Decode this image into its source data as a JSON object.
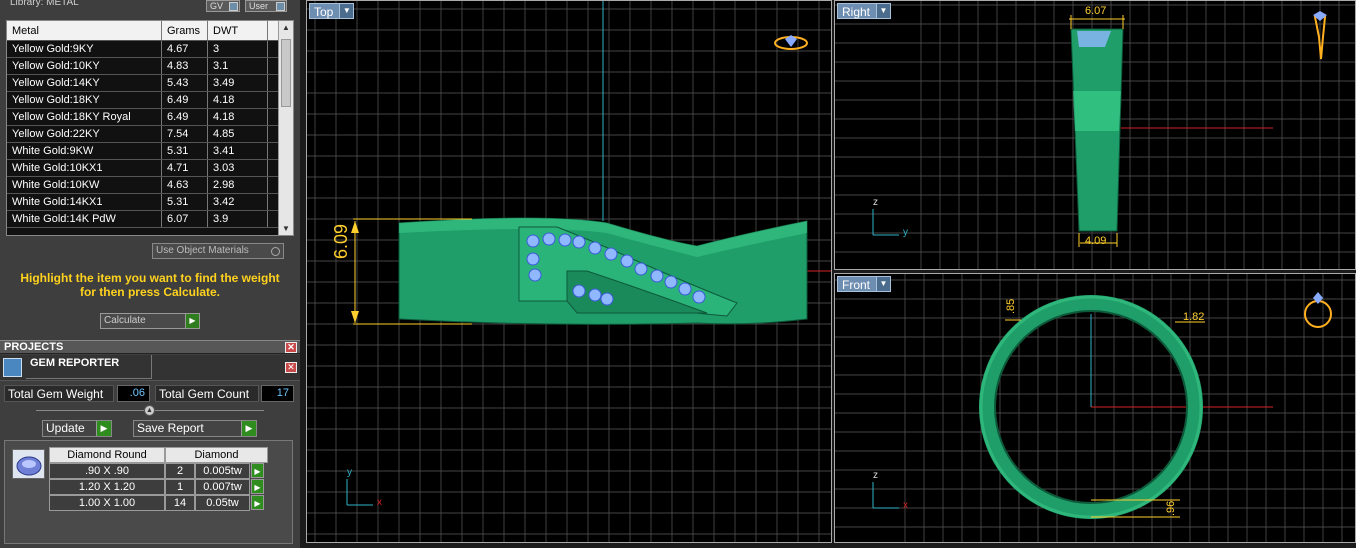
{
  "library": {
    "title": "Library: METAL",
    "btn_gv": "GV",
    "btn_user": "User",
    "table": {
      "headers": [
        "Metal",
        "Grams",
        "DWT"
      ],
      "rows": [
        [
          "Yellow Gold:9KY",
          "4.67",
          "3"
        ],
        [
          "Yellow Gold:10KY",
          "4.83",
          "3.1"
        ],
        [
          "Yellow Gold:14KY",
          "5.43",
          "3.49"
        ],
        [
          "Yellow Gold:18KY",
          "6.49",
          "4.18"
        ],
        [
          "Yellow Gold:18KY Royal",
          "6.49",
          "4.18"
        ],
        [
          "Yellow Gold:22KY",
          "7.54",
          "4.85"
        ],
        [
          "White Gold:9KW",
          "5.31",
          "3.41"
        ],
        [
          "White Gold:10KX1",
          "4.71",
          "3.03"
        ],
        [
          "White Gold:10KW",
          "4.63",
          "2.98"
        ],
        [
          "White Gold:14KX1",
          "5.31",
          "3.42"
        ],
        [
          "White Gold:14K PdW",
          "6.07",
          "3.9"
        ]
      ]
    },
    "use_object_materials": "Use Object Materials",
    "hint": "Highlight the item you want to find the weight for then press Calculate.",
    "calculate_label": "Calculate"
  },
  "projects": {
    "title": "PROJECTS",
    "gem_reporter_title": "GEM REPORTER",
    "total_gem_weight_label": "Total Gem Weight",
    "total_gem_weight_value": ".06",
    "total_gem_count_label": "Total Gem Count",
    "total_gem_count_value": "17",
    "update_label": "Update",
    "save_report_label": "Save Report",
    "gem_table": {
      "headers": [
        "Diamond Round",
        "Diamond"
      ],
      "rows": [
        {
          "size": ".90 X .90",
          "count": "2",
          "weight": "0.005tw"
        },
        {
          "size": "1.20 X 1.20",
          "count": "1",
          "weight": "0.007tw"
        },
        {
          "size": "1.00 X 1.00",
          "count": "14",
          "weight": "0.05tw"
        }
      ]
    }
  },
  "viewports": {
    "top": {
      "label": "Top",
      "dim": "6.09",
      "axis_y": "y",
      "axis_x": "x"
    },
    "right": {
      "label": "Right",
      "dim_top": "6.07",
      "dim_bottom": "4.09",
      "axis_z": "z",
      "axis_y": "y"
    },
    "front": {
      "label": "Front",
      "dim_a": ".85",
      "dim_b": "1.82",
      "dim_c": ".96",
      "axis_z": "z",
      "axis_x": "x"
    }
  },
  "colors": {
    "ring_green": "#1f9e6a",
    "grid": "#5a5a5a",
    "dimension": "#ffcf2e",
    "gem_blue": "#8fb8ff",
    "axis_cyan": "#2fb3c9",
    "axis_red": "#d42222"
  }
}
